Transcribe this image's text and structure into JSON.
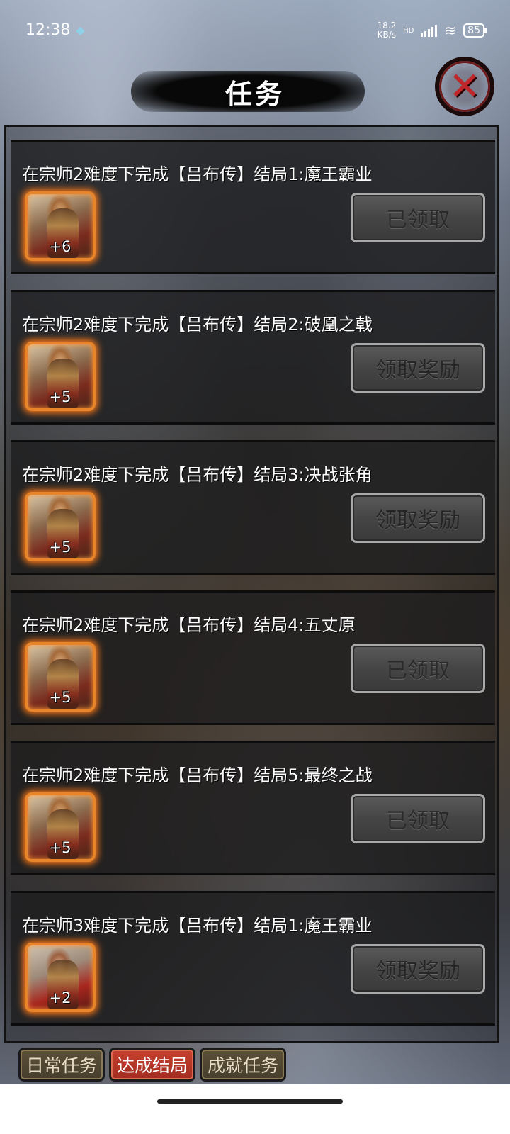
{
  "status_bar": {
    "time": "12:38",
    "net_speed": "18.2",
    "net_unit": "KB/s",
    "net_label": "HD",
    "battery": "85"
  },
  "header": {
    "title": "任务",
    "close_icon": "close-icon"
  },
  "tasks": [
    {
      "title": "在宗师2难度下完成【吕布传】结局1:魔王霸业",
      "reward_count": "+6",
      "button_label": "已领取",
      "state": "claimed",
      "portrait": "lu-bu-portrait"
    },
    {
      "title": "在宗师2难度下完成【吕布传】结局2:破凰之戟",
      "reward_count": "+5",
      "button_label": "领取奖励",
      "state": "claimable",
      "portrait": "lu-bu-portrait"
    },
    {
      "title": "在宗师2难度下完成【吕布传】结局3:决战张角",
      "reward_count": "+5",
      "button_label": "领取奖励",
      "state": "claimable",
      "portrait": "lu-bu-portrait"
    },
    {
      "title": "在宗师2难度下完成【吕布传】结局4:五丈原",
      "reward_count": "+5",
      "button_label": "已领取",
      "state": "claimed",
      "portrait": "lu-bu-portrait"
    },
    {
      "title": "在宗师2难度下完成【吕布传】结局5:最终之战",
      "reward_count": "+5",
      "button_label": "已领取",
      "state": "claimed",
      "portrait": "lu-bu-portrait"
    },
    {
      "title": "在宗师3难度下完成【吕布传】结局1:魔王霸业",
      "reward_count": "+2",
      "button_label": "领取奖励",
      "state": "claimable",
      "portrait": "warrior-portrait"
    }
  ],
  "tabs": [
    {
      "label": "日常任务",
      "active": false
    },
    {
      "label": "达成结局",
      "active": true
    },
    {
      "label": "成就任务",
      "active": false
    }
  ],
  "colors": {
    "active_tab": "#c8402e",
    "inactive_tab": "#5b5038",
    "reward_glow": "#ff7a18",
    "close_x": "#c0272b"
  }
}
